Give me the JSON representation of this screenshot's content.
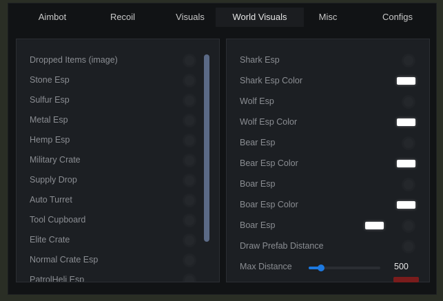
{
  "tabs": [
    "Aimbot",
    "Recoil",
    "Visuals",
    "World Visuals",
    "Misc",
    "Configs"
  ],
  "active_tab": "World Visuals",
  "left_panel": {
    "items": [
      {
        "label": "Dropped Items (image)",
        "enabled": false
      },
      {
        "label": "Stone Esp",
        "enabled": false
      },
      {
        "label": "Sulfur Esp",
        "enabled": false
      },
      {
        "label": "Metal Esp",
        "enabled": false
      },
      {
        "label": "Hemp Esp",
        "enabled": false
      },
      {
        "label": "Military Crate",
        "enabled": false
      },
      {
        "label": "Supply Drop",
        "enabled": false
      },
      {
        "label": "Auto Turret",
        "enabled": false
      },
      {
        "label": "Tool Cupboard",
        "enabled": false
      },
      {
        "label": "Elite Crate",
        "enabled": false
      },
      {
        "label": "Normal Crate Esp",
        "enabled": false
      },
      {
        "label": "PatrolHeli Esp",
        "enabled": false
      }
    ]
  },
  "right_panel": {
    "items": [
      {
        "label": "Shark Esp",
        "kind": "toggle",
        "enabled": false
      },
      {
        "label": "Shark Esp Color",
        "kind": "color",
        "color": "#ffffff"
      },
      {
        "label": "Wolf Esp",
        "kind": "toggle",
        "enabled": false
      },
      {
        "label": "Wolf Esp Color",
        "kind": "color",
        "color": "#ffffff"
      },
      {
        "label": "Bear Esp",
        "kind": "toggle",
        "enabled": false
      },
      {
        "label": "Bear Esp Color",
        "kind": "color",
        "color": "#ffffff"
      },
      {
        "label": "Boar Esp",
        "kind": "toggle",
        "enabled": false
      },
      {
        "label": "Boar Esp Color",
        "kind": "color",
        "color": "#ffffff"
      },
      {
        "label": "Boar Esp",
        "kind": "toggle_color",
        "enabled": false,
        "color": "#ffffff"
      },
      {
        "label": "Draw Prefab Distance",
        "kind": "toggle",
        "enabled": false
      }
    ],
    "max_distance": {
      "label": "Max Distance",
      "value": "500",
      "fraction": 0.17
    }
  },
  "colors": {
    "accent": "#1d79e0",
    "scrollbar": "#5b6a86",
    "danger": "#7a1c1c"
  }
}
